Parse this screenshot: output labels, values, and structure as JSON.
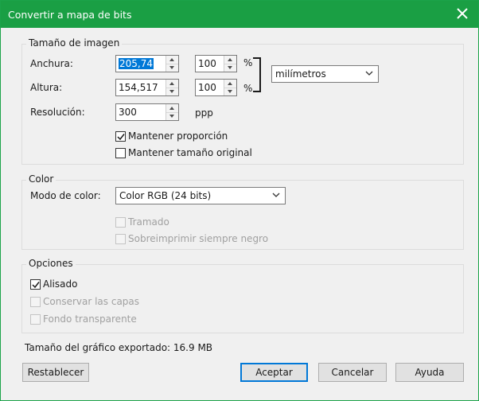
{
  "window": {
    "title": "Convertir a mapa de bits"
  },
  "image_size": {
    "legend": "Tamaño de imagen",
    "width_label": "Anchura:",
    "width_value": "205,74",
    "width_percent": "100",
    "height_label": "Altura:",
    "height_value": "154,517",
    "height_percent": "100",
    "percent_symbol": "%",
    "units_value": "milímetros",
    "resolution_label": "Resolución:",
    "resolution_value": "300",
    "resolution_unit": "ppp",
    "keep_ratio_label": "Mantener proporción",
    "keep_ratio_checked": true,
    "keep_original_label": "Mantener tamaño original",
    "keep_original_checked": false
  },
  "color": {
    "legend": "Color",
    "mode_label": "Modo de color:",
    "mode_value": "Color RGB (24 bits)",
    "dither_label": "Tramado",
    "overprint_label": "Sobreimprimir siempre negro"
  },
  "options": {
    "legend": "Opciones",
    "antialias_label": "Alisado",
    "antialias_checked": true,
    "keep_layers_label": "Conservar las capas",
    "transparent_label": "Fondo transparente"
  },
  "export_size_text": "Tamaño del gráfico exportado: 16.9 MB",
  "buttons": {
    "reset": "Restablecer",
    "ok": "Aceptar",
    "cancel": "Cancelar",
    "help": "Ayuda"
  },
  "colors": {
    "titlebar": "#1a9f44",
    "accent": "#0078d7"
  }
}
